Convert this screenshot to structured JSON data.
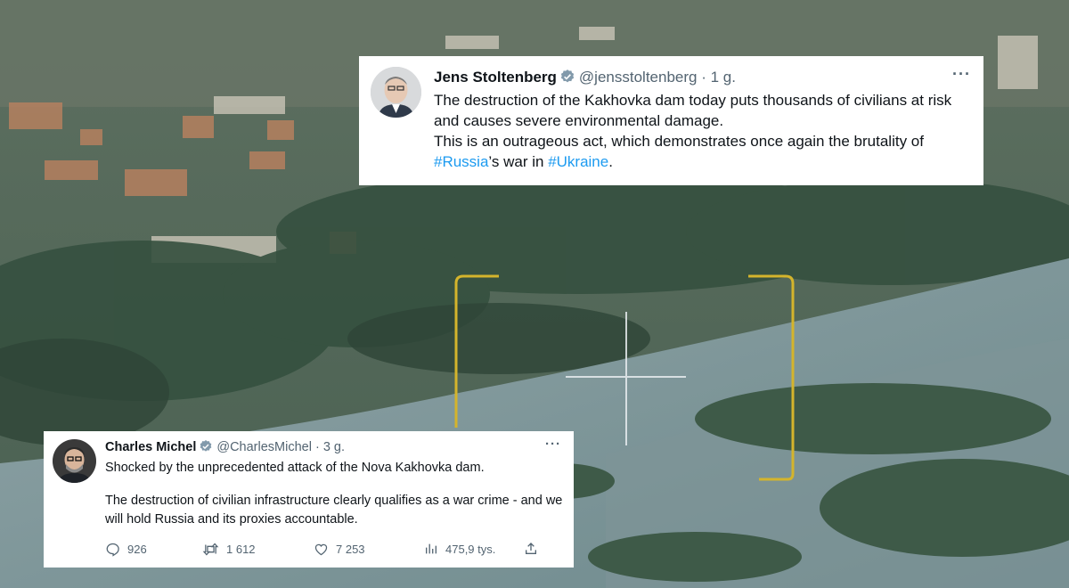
{
  "tweets": [
    {
      "author_name": "Jens Stoltenberg",
      "handle": "@jensstoltenberg",
      "time": "1 g.",
      "text_1": "The destruction of the Kakhovka dam today puts thousands of civilians at risk and causes severe environmental damage.",
      "text_2_a": "This is an outrageous act, which demonstrates once again the brutality of ",
      "hashtag_russia": "#Russia",
      "text_2_b": "’s war in ",
      "hashtag_ukraine": "#Ukraine",
      "text_2_c": "."
    },
    {
      "author_name": "Charles Michel",
      "handle": "@CharlesMichel",
      "time": "3 g.",
      "text_1": "Shocked by the unprecedented attack of the Nova Kakhovka dam.",
      "text_2": "The destruction of civilian infrastructure clearly qualifies as a war crime - and we will hold Russia and its proxies accountable.",
      "replies": "926",
      "retweets": "1 612",
      "likes": "7 253",
      "views": "475,9 tys."
    }
  ],
  "colors": {
    "verified": "#829aab",
    "hashtag": "#1d9bf0",
    "frame": "#d4b42c"
  },
  "icons": [
    "verified-badge-icon",
    "more-icon",
    "reply-icon",
    "retweet-icon",
    "like-icon",
    "views-icon",
    "share-icon"
  ]
}
